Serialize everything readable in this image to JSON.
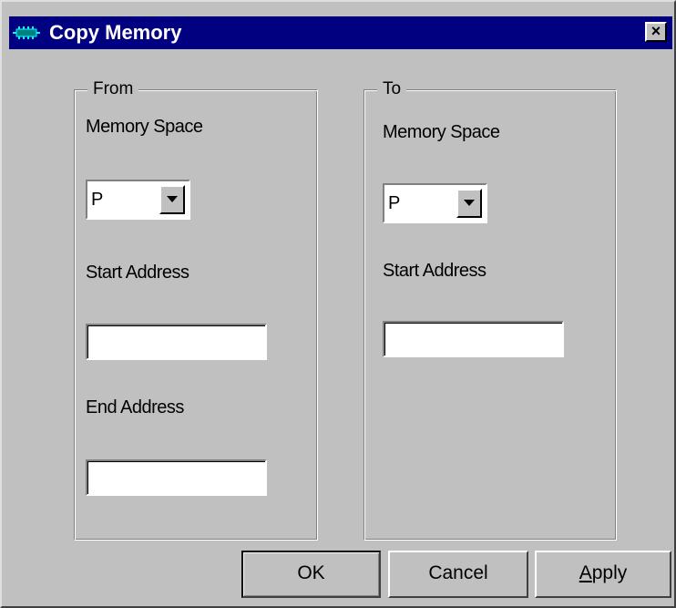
{
  "window": {
    "title": "Copy Memory",
    "close_glyph": "×"
  },
  "from": {
    "legend": "From",
    "memory_space_label": "Memory Space",
    "memory_space_value": "P",
    "start_address_label": "Start Address",
    "start_address_value": "",
    "end_address_label": "End Address",
    "end_address_value": ""
  },
  "to": {
    "legend": "To",
    "memory_space_label": "Memory Space",
    "memory_space_value": "P",
    "start_address_label": "Start Address",
    "start_address_value": ""
  },
  "buttons": {
    "ok": "OK",
    "cancel": "Cancel",
    "apply_mnemonic": "A",
    "apply_rest": "pply"
  },
  "colors": {
    "titlebar": "#000080",
    "dialog_face": "#c0c0c0"
  },
  "icons": {
    "title_icon": "memory-chip-icon",
    "close_icon": "close-icon",
    "dropdown_icon": "chevron-down-icon"
  }
}
